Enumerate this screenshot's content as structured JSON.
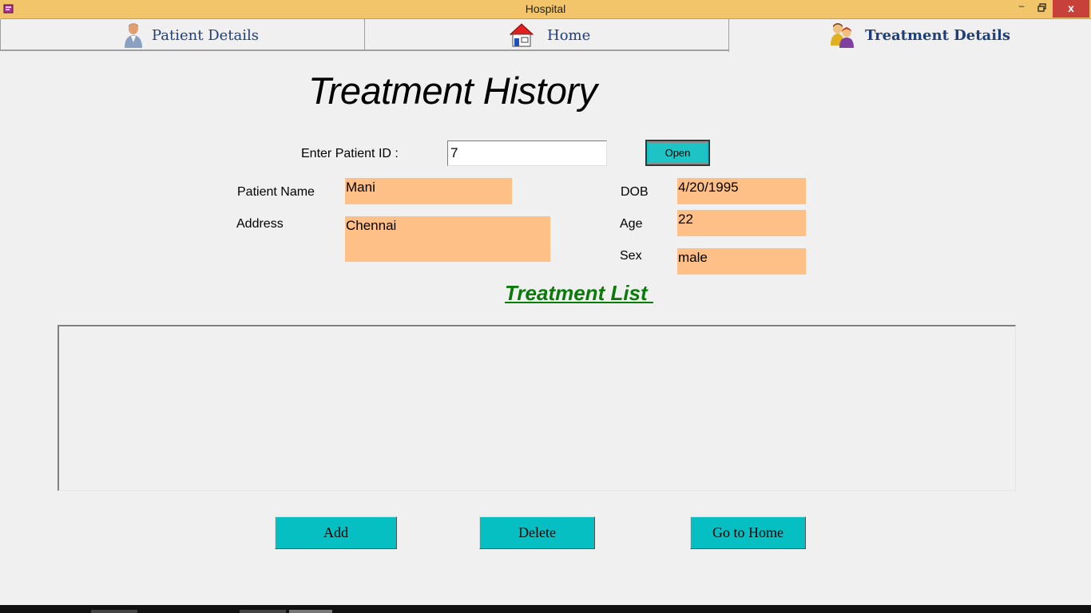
{
  "window": {
    "title": "Hospital",
    "minimize": "–",
    "maximize": "❐",
    "close": "x"
  },
  "tabs": [
    {
      "label": "Patient Details",
      "icon": "person-icon"
    },
    {
      "label": "Home",
      "icon": "house-icon"
    },
    {
      "label": "Treatment Details",
      "icon": "group-icon",
      "selected": true
    }
  ],
  "page": {
    "heading": "Treatment History"
  },
  "search": {
    "label": "Enter Patient ID :",
    "value": "7",
    "open_label": "Open"
  },
  "patient": {
    "name_label": "Patient Name",
    "name": "Mani",
    "address_label": "Address",
    "address": "Chennai",
    "dob_label": "DOB",
    "dob": "4/20/1995",
    "age_label": "Age",
    "age": "22",
    "sex_label": "Sex",
    "sex": "male"
  },
  "treatment": {
    "title": "Treatment List "
  },
  "actions": {
    "add": "Add",
    "delete": "Delete",
    "home": "Go to Home"
  },
  "colors": {
    "titlebar": "#f2c56a",
    "field_bg": "#ffc088",
    "button_bg": "#06bfc3",
    "list_title": "#0a7a0a",
    "close": "#c7403a"
  }
}
